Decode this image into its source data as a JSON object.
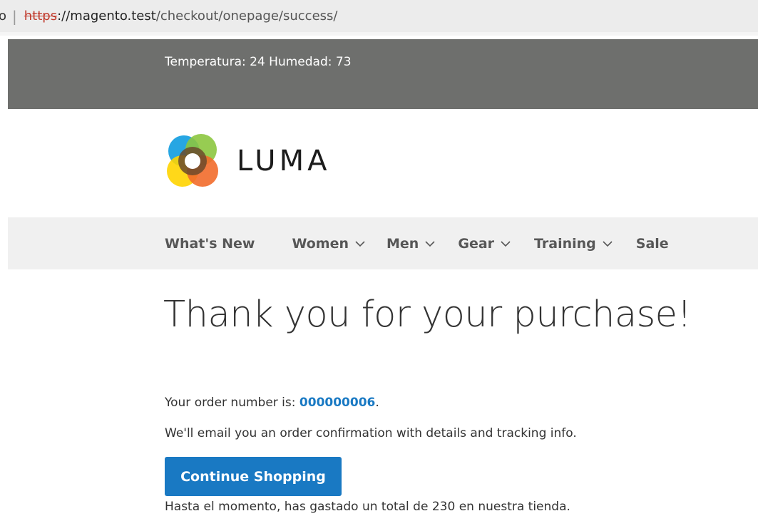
{
  "browser": {
    "url_lead": "o",
    "url_scheme": "https",
    "url_host": "://magento.test",
    "url_path": "/checkout/onepage/success/"
  },
  "topbar": {
    "weather_text": "Temperatura: 24 Humedad: 73"
  },
  "header": {
    "logo_text": "LUMA",
    "logo_colors": [
      "#1ba1e2",
      "#8cc63f",
      "#ffd400",
      "#f26c2b",
      "#6b4a2b"
    ]
  },
  "nav": {
    "items": [
      {
        "label": "What's New",
        "has_dropdown": false
      },
      {
        "label": "Women",
        "has_dropdown": true
      },
      {
        "label": "Men",
        "has_dropdown": true
      },
      {
        "label": "Gear",
        "has_dropdown": true
      },
      {
        "label": "Training",
        "has_dropdown": true
      },
      {
        "label": "Sale",
        "has_dropdown": false
      }
    ]
  },
  "main": {
    "title": "Thank you for your purchase!",
    "order_prefix": "Your order number is: ",
    "order_number": "000000006",
    "order_suffix": ".",
    "confirmation_text": "We'll email you an order confirmation with details and tracking info.",
    "continue_label": "Continue Shopping",
    "spent_text": "Hasta el momento, has gastado un total de 230 en nuestra tienda."
  },
  "colors": {
    "accent": "#1979c3",
    "topbar": "#6e6f6d",
    "nav_bg": "#f0f0f0"
  }
}
